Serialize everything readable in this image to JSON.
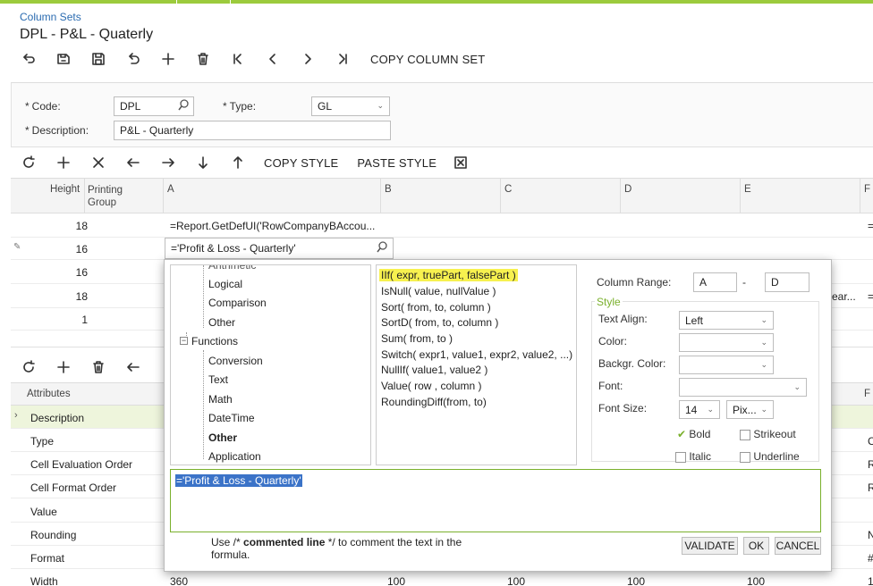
{
  "header": {
    "breadcrumb": "Column Sets",
    "title": "DPL - P&L - Quaterly"
  },
  "main_toolbar": {
    "copy_column_set": "COPY COLUMN SET"
  },
  "form": {
    "code_label": "Code:",
    "code_value": "DPL",
    "type_label": "Type:",
    "type_value": "GL",
    "description_label": "Description:",
    "description_value": "P&L - Quarterly",
    "required_mark": "*"
  },
  "grid_toolbar": {
    "copy_style": "COPY STYLE",
    "paste_style": "PASTE STYLE"
  },
  "columns_grid": {
    "headers": [
      "Height",
      "Printing\nGroup",
      "A",
      "B",
      "C",
      "D",
      "E",
      "F"
    ],
    "header_printing_1": "Printing",
    "header_printing_2": "Group",
    "rows": [
      {
        "height": "18",
        "a": "=Report.GetDefUI('RowCompanyBAccou...",
        "f": "="
      },
      {
        "height": "16",
        "a": "='Profit & Loss - Quarterly'",
        "f": ""
      },
      {
        "height": "16",
        "a": "",
        "f": ""
      },
      {
        "height": "18",
        "a": "",
        "e_tail": "ear...",
        "f": "="
      },
      {
        "height": "1",
        "a": "",
        "f": ""
      }
    ]
  },
  "attributes_grid": {
    "header": "Attributes",
    "header_f": "F",
    "rows": [
      {
        "name": "Description",
        "f": ""
      },
      {
        "name": "Type",
        "f": "C"
      },
      {
        "name": "Cell Evaluation Order",
        "f": "R"
      },
      {
        "name": "Cell Format Order",
        "f": "R"
      },
      {
        "name": "Value",
        "f": ""
      },
      {
        "name": "Rounding",
        "f": "N"
      },
      {
        "name": "Format",
        "f": "#"
      },
      {
        "name": "Width",
        "a": "360",
        "b": "100",
        "c": "100",
        "d": "100",
        "e": "100",
        "f": "1"
      }
    ]
  },
  "dialog": {
    "tree": [
      {
        "label": "Arithmetic",
        "level": 2,
        "bold": false
      },
      {
        "label": "Logical",
        "level": 2,
        "bold": false
      },
      {
        "label": "Comparison",
        "level": 2,
        "bold": false
      },
      {
        "label": "Other",
        "level": 2,
        "bold": false
      },
      {
        "label": "Functions",
        "level": 1,
        "bold": false
      },
      {
        "label": "Conversion",
        "level": 2,
        "bold": false
      },
      {
        "label": "Text",
        "level": 2,
        "bold": false
      },
      {
        "label": "Math",
        "level": 2,
        "bold": false
      },
      {
        "label": "DateTime",
        "level": 2,
        "bold": false
      },
      {
        "label": "Other",
        "level": 2,
        "bold": true
      },
      {
        "label": "Application",
        "level": 2,
        "bold": false
      }
    ],
    "functions": [
      "IIf( expr, truePart, falsePart )",
      "IsNull( value, nullValue )",
      "Sort( from, to, column )",
      "SortD( from, to, column )",
      "Sum( from, to )",
      "Switch( expr1, value1, expr2, value2, ...)",
      "NullIf( value1, value2 )",
      "Value( row , column )",
      "RoundingDiff(from, to)"
    ],
    "column_range_label": "Column Range:",
    "range_from": "A",
    "range_sep": "-",
    "range_to": "D",
    "style_legend": "Style",
    "text_align_label": "Text Align:",
    "text_align_value": "Left",
    "color_label": "Color:",
    "backgr_color_label": "Backgr. Color:",
    "font_label": "Font:",
    "font_size_label": "Font Size:",
    "font_size_value": "14",
    "font_unit_value": "Pix...",
    "bold_label": "Bold",
    "strikeout_label": "Strikeout",
    "italic_label": "Italic",
    "underline_label": "Underline",
    "formula": "='Profit & Loss - Quarterly'",
    "hint_1": "Use /* ",
    "hint_bold": "commented line",
    "hint_2": " */ to comment the text in the",
    "hint_3": "formula.",
    "validate": "VALIDATE",
    "ok": "OK",
    "cancel": "CANCEL",
    "highlight_color": "#f7f14f",
    "selection_color": "#3b73c8"
  },
  "colors": {
    "accent_green": "#9ccb3d",
    "link_blue": "#2a6bb0",
    "legend_green": "#7ab02c"
  }
}
